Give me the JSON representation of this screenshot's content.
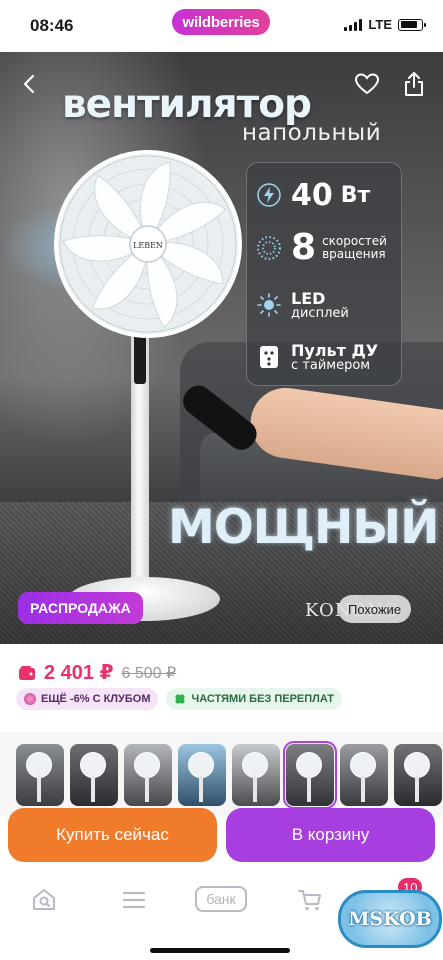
{
  "status_bar": {
    "time": "08:46",
    "app_pill": "wildberries",
    "network": "LTE",
    "battery_level": 0.8
  },
  "product": {
    "image": {
      "title": "вентилятор",
      "subtitle": "напольный",
      "slogan": "МОЩНЫЙ",
      "brand": "KONONO",
      "fan_brand": "LEBEN",
      "features": [
        {
          "icon": "lightning-icon",
          "big": "40",
          "text": "Вт"
        },
        {
          "icon": "dotted-circle-icon",
          "big": "8",
          "text": "скоростей вращения"
        },
        {
          "icon": "sun-icon",
          "title": "LED",
          "sub": "дисплей"
        },
        {
          "icon": "remote-icon",
          "title": "Пульт ДУ",
          "sub": "с таймером"
        }
      ],
      "sale_badge": "РАСПРОДАЖА",
      "similar_button": "Похожие"
    },
    "price": {
      "current": "2 401 ₽",
      "old": "6 500 ₽"
    },
    "chips": {
      "club": "ЕЩЁ -6% С КЛУБОМ",
      "parts": "ЧАСТЯМИ БЕЗ ПЕРЕПЛАТ"
    },
    "thumbnails_count": 8,
    "active_thumbnail": 5
  },
  "actions": {
    "buy_now": "Купить сейчас",
    "add_to_cart": "В корзину"
  },
  "bottom_nav": {
    "items": [
      "search-icon",
      "menu-icon",
      "bank",
      "cart-icon",
      "profile-icon"
    ],
    "bank_label": "банк",
    "cart_badge": "10"
  },
  "watermark": "MSKOB",
  "colors": {
    "accent_purple": "#a73ee0",
    "accent_orange": "#ef7b2b",
    "price_pink": "#e8326a"
  }
}
